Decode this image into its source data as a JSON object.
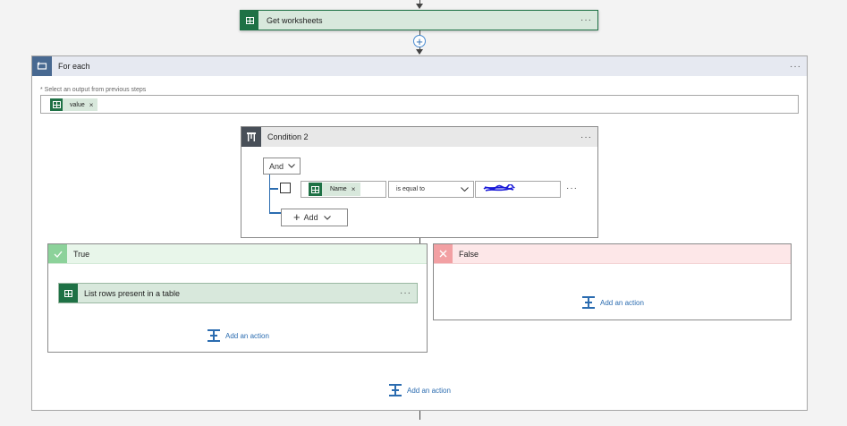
{
  "get_worksheets": {
    "title": "Get worksheets",
    "menu": "···"
  },
  "connector_plus": "+",
  "for_each": {
    "title": "For each",
    "menu": "···",
    "select_label": "* Select an output from previous steps",
    "token_label": "value",
    "token_remove": "×",
    "add_action": "Add an action"
  },
  "condition": {
    "title": "Condition 2",
    "menu": "···",
    "group_operator": "And",
    "row_token": "Name",
    "row_token_remove": "×",
    "operator": "is equal to",
    "row_menu": "···",
    "add_label": "Add"
  },
  "true_branch": {
    "title": "True",
    "action_title": "List rows present in a table",
    "action_menu": "···",
    "add_action": "Add an action"
  },
  "false_branch": {
    "title": "False",
    "add_action": "Add an action"
  },
  "colors": {
    "excel_green": "#1e7145",
    "true_header": "#e8f6ea",
    "false_header": "#fde7e8",
    "for_each_header": "#e6e9f1",
    "link_blue": "#2b6cb0"
  }
}
